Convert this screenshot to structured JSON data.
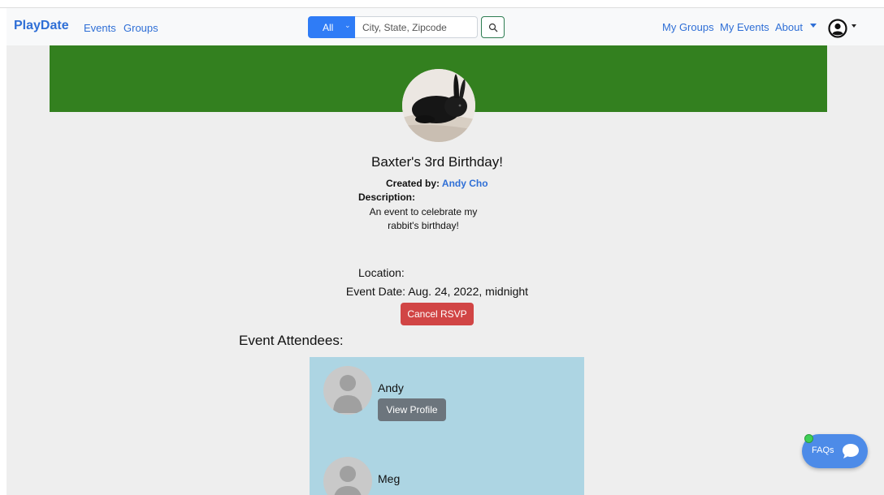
{
  "nav": {
    "brand": "PlayDate",
    "links": [
      "Events",
      "Groups"
    ],
    "search": {
      "filter": "All",
      "placeholder": "City, State, Zipcode"
    },
    "right_links": [
      "My Groups",
      "My Events",
      "About"
    ],
    "icons": {
      "search": "search-icon",
      "user": "user-circle-icon"
    }
  },
  "event": {
    "title": "Baxter's 3rd Birthday!",
    "created_by_label": "Created by:",
    "author": "Andy Cho",
    "description_label": "Description:",
    "description": "An event to celebrate my rabbit's birthday!",
    "location_label": "Location:",
    "date_text": "Event Date: Aug. 24, 2022, midnight",
    "cancel_label": "Cancel RSVP",
    "photo_icon": "rabbit-photo",
    "banner_color": "#33801f"
  },
  "attendees": {
    "title": "Event Attendees:",
    "items": [
      {
        "name": "Andy",
        "button": "View Profile"
      },
      {
        "name": "Meg"
      }
    ]
  },
  "faq": {
    "label": "FAQs",
    "icon": "chat-bubble-icon",
    "status_color": "#3ecf55"
  }
}
